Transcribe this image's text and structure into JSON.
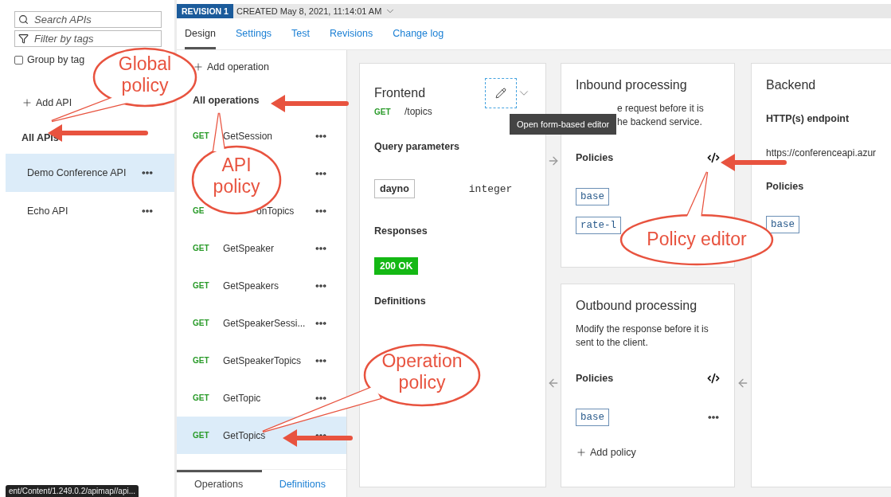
{
  "sidebar": {
    "search_placeholder": "Search APIs",
    "filter_placeholder": "Filter by tags",
    "group_by_tag": {
      "label": "Group by tag",
      "checked": false
    },
    "add_api": "Add API",
    "all_apis": "All APIs",
    "apis": [
      {
        "name": "Demo Conference API",
        "selected": true
      },
      {
        "name": "Echo API",
        "selected": false
      }
    ]
  },
  "revision": {
    "badge": "REVISION 1",
    "created": "CREATED May 8, 2021, 11:14:01 AM"
  },
  "tabs": [
    {
      "label": "Design",
      "selected": true
    },
    {
      "label": "Settings",
      "selected": false
    },
    {
      "label": "Test",
      "selected": false
    },
    {
      "label": "Revisions",
      "selected": false
    },
    {
      "label": "Change log",
      "selected": false
    }
  ],
  "operations": {
    "add": "Add operation",
    "all": "All operations",
    "items": [
      {
        "kind": "full",
        "method": "GET",
        "name": "GetSession",
        "selected": false
      },
      {
        "kind": "covered"
      },
      {
        "kind": "partial",
        "method": "GE",
        "name": "onTopics"
      },
      {
        "kind": "full",
        "method": "GET",
        "name": "GetSpeaker",
        "selected": false
      },
      {
        "kind": "full",
        "method": "GET",
        "name": "GetSpeakers",
        "selected": false
      },
      {
        "kind": "full",
        "method": "GET",
        "name": "GetSpeakerSessi...",
        "selected": false
      },
      {
        "kind": "full",
        "method": "GET",
        "name": "GetSpeakerTopics",
        "selected": false
      },
      {
        "kind": "full",
        "method": "GET",
        "name": "GetTopic",
        "selected": false
      },
      {
        "kind": "full",
        "method": "GET",
        "name": "GetTopics",
        "selected": true
      }
    ],
    "tabs": [
      {
        "label": "Operations",
        "selected": true
      },
      {
        "label": "Definitions",
        "selected": false
      }
    ]
  },
  "frontend": {
    "title": "Frontend",
    "method": "GET",
    "path": "/topics",
    "query_heading": "Query parameters",
    "param": {
      "name": "dayno",
      "type": "integer"
    },
    "responses_heading": "Responses",
    "response": "200 OK",
    "definitions_heading": "Definitions"
  },
  "tooltip": "Open form-based editor",
  "inbound": {
    "title": "Inbound processing",
    "description": [
      "e request before it is",
      "he backend service."
    ],
    "policies_heading": "Policies",
    "policies": [
      "base",
      "rate-l"
    ]
  },
  "outbound": {
    "title": "Outbound processing",
    "description": "Modify the response before it is sent to the client.",
    "policies_heading": "Policies",
    "policies": [
      "base"
    ],
    "add_policy": "Add policy"
  },
  "backend": {
    "title": "Backend",
    "endpoint_heading": "HTTP(s) endpoint",
    "endpoint": "https://conferenceapi.azur",
    "policies_heading": "Policies",
    "policies": [
      "base"
    ]
  },
  "status_url": "ent/Content/1.249.0.2/apimap//api...",
  "callouts": [
    {
      "lines": [
        "Global",
        "policy"
      ]
    },
    {
      "lines": [
        "API",
        "policy"
      ]
    },
    {
      "lines": [
        "Policy editor"
      ]
    },
    {
      "lines": [
        "Operation",
        "policy"
      ]
    }
  ]
}
